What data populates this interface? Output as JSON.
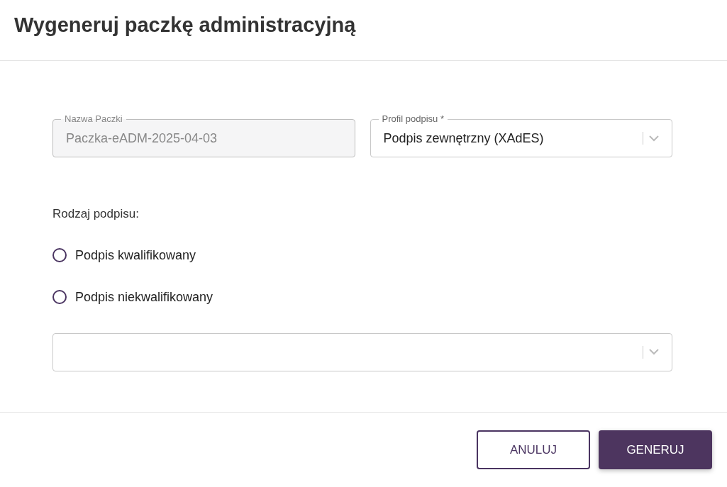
{
  "dialog": {
    "title": "Wygeneruj paczkę administracyjną"
  },
  "fields": [
    {
      "kind": "text",
      "label": "Nazwa Paczki",
      "value": "Paczka-eADM-2025-04-03",
      "disabled": true
    },
    {
      "kind": "select",
      "label": "Profil podpisu *",
      "value": "Podpis zewnętrzny (XAdES)",
      "disabled": false
    }
  ],
  "signature_type": {
    "label": "Rodzaj podpisu:",
    "options": [
      {
        "label": "Podpis kwalifikowany",
        "selected": false
      },
      {
        "label": "Podpis niekwalifikowany",
        "selected": false
      }
    ]
  },
  "extra_select": {
    "kind": "select"
  },
  "buttons": [
    {
      "kind": "outline",
      "label": "ANULUJ"
    },
    {
      "kind": "primary",
      "label": "GENERUJ"
    }
  ]
}
